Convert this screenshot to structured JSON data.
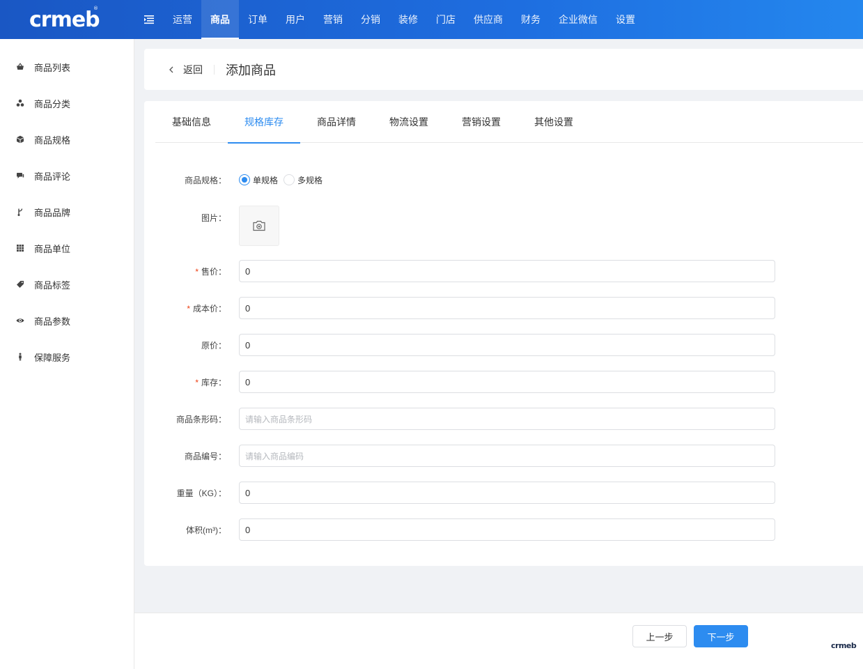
{
  "brand": {
    "logo_text": "crmeb",
    "registered_mark": "®",
    "accent": "#2d8cf0",
    "header_gradient": [
      "#1a57c4",
      "#2487ee"
    ],
    "required_color": "#ed4014"
  },
  "header": {
    "nav": [
      {
        "label": "运营",
        "active": false
      },
      {
        "label": "商品",
        "active": true
      },
      {
        "label": "订单",
        "active": false
      },
      {
        "label": "用户",
        "active": false
      },
      {
        "label": "营销",
        "active": false
      },
      {
        "label": "分销",
        "active": false
      },
      {
        "label": "装修",
        "active": false
      },
      {
        "label": "门店",
        "active": false
      },
      {
        "label": "供应商",
        "active": false
      },
      {
        "label": "财务",
        "active": false
      },
      {
        "label": "企业微信",
        "active": false
      },
      {
        "label": "设置",
        "active": false
      }
    ]
  },
  "sidebar": {
    "items": [
      {
        "label": "商品列表",
        "icon": "basket-icon"
      },
      {
        "label": "商品分类",
        "icon": "cluster-icon"
      },
      {
        "label": "商品规格",
        "icon": "cube-icon"
      },
      {
        "label": "商品评论",
        "icon": "comment-icon"
      },
      {
        "label": "商品品牌",
        "icon": "brand-icon"
      },
      {
        "label": "商品单位",
        "icon": "grid-icon"
      },
      {
        "label": "商品标签",
        "icon": "tag-icon"
      },
      {
        "label": "商品参数",
        "icon": "eye-icon"
      },
      {
        "label": "保障服务",
        "icon": "person-icon"
      }
    ]
  },
  "page": {
    "back_label": "返回",
    "title": "添加商品"
  },
  "tabs": [
    {
      "label": "基础信息",
      "active": false
    },
    {
      "label": "规格库存",
      "active": true
    },
    {
      "label": "商品详情",
      "active": false
    },
    {
      "label": "物流设置",
      "active": false
    },
    {
      "label": "营销设置",
      "active": false
    },
    {
      "label": "其他设置",
      "active": false
    }
  ],
  "form": {
    "spec": {
      "label": "商品规格：",
      "options": [
        {
          "label": "单规格",
          "checked": true
        },
        {
          "label": "多规格",
          "checked": false
        }
      ]
    },
    "image": {
      "label": "图片："
    },
    "price": {
      "label": "售价：",
      "value": "0",
      "required": true
    },
    "cost": {
      "label": "成本价：",
      "value": "0",
      "required": true
    },
    "original": {
      "label": "原价：",
      "value": "0",
      "required": false
    },
    "stock": {
      "label": "库存：",
      "value": "0",
      "required": true
    },
    "barcode": {
      "label": "商品条形码：",
      "value": "",
      "placeholder": "请输入商品条形码"
    },
    "code": {
      "label": "商品编号：",
      "value": "",
      "placeholder": "请输入商品编码"
    },
    "weight": {
      "label": "重量（KG）：",
      "value": "0"
    },
    "volume": {
      "label": "体积(m³)：",
      "value": "0"
    }
  },
  "footer": {
    "prev_label": "上一步",
    "next_label": "下一步",
    "watermark": "crmeb"
  }
}
